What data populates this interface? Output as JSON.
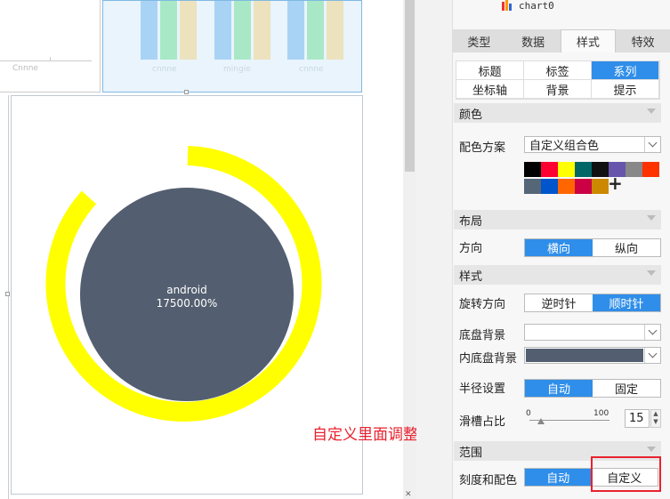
{
  "canvas": {
    "tl_axis_label": "Cnnne",
    "bar_labels": [
      "cnnne",
      "mingie",
      "cnnne"
    ],
    "bar_colors": [
      "#a9d3f5",
      "#a9e8c7",
      "#ece2bd"
    ]
  },
  "gauge": {
    "series_name": "android",
    "value_text": "17500.00%",
    "ring_color": "#ffff00",
    "inner_color": "#535f70"
  },
  "panel": {
    "chart_name": "chart0",
    "tabs": [
      "类型",
      "数据",
      "样式",
      "特效"
    ],
    "active_tab": "样式",
    "subtabs": [
      "标题",
      "标签",
      "系列",
      "坐标轴",
      "背景",
      "提示"
    ],
    "active_subtab": "系列",
    "color_section": "颜色",
    "color_scheme_label": "配色方案",
    "color_scheme_value": "自定义组合色",
    "palette": [
      "#000000",
      "#ff0033",
      "#ffff00",
      "#006666",
      "#111111",
      "#6655aa",
      "#888888",
      "#ff3300",
      "#556677",
      "#0055cc",
      "#ff6600",
      "#cc0044",
      "#cc8800"
    ],
    "add_color": "+",
    "layout_section": "布局",
    "direction_label": "方向",
    "direction_options": [
      "横向",
      "纵向"
    ],
    "style_section": "样式",
    "rotation_label": "旋转方向",
    "rotation_options": [
      "逆时针",
      "顺时针"
    ],
    "base_bg_label": "底盘背景",
    "inner_bg_label": "内底盘背景",
    "inner_bg_color": "#535f70",
    "radius_label": "半径设置",
    "radius_options": [
      "自动",
      "固定"
    ],
    "groove_label": "滑槽占比",
    "slider_min": "0",
    "slider_max": "100",
    "groove_value": "15",
    "range_section": "范围",
    "scale_label": "刻度和配色",
    "scale_options": [
      "自动",
      "自定义"
    ]
  },
  "annotation": {
    "text": "自定义里面调整"
  }
}
